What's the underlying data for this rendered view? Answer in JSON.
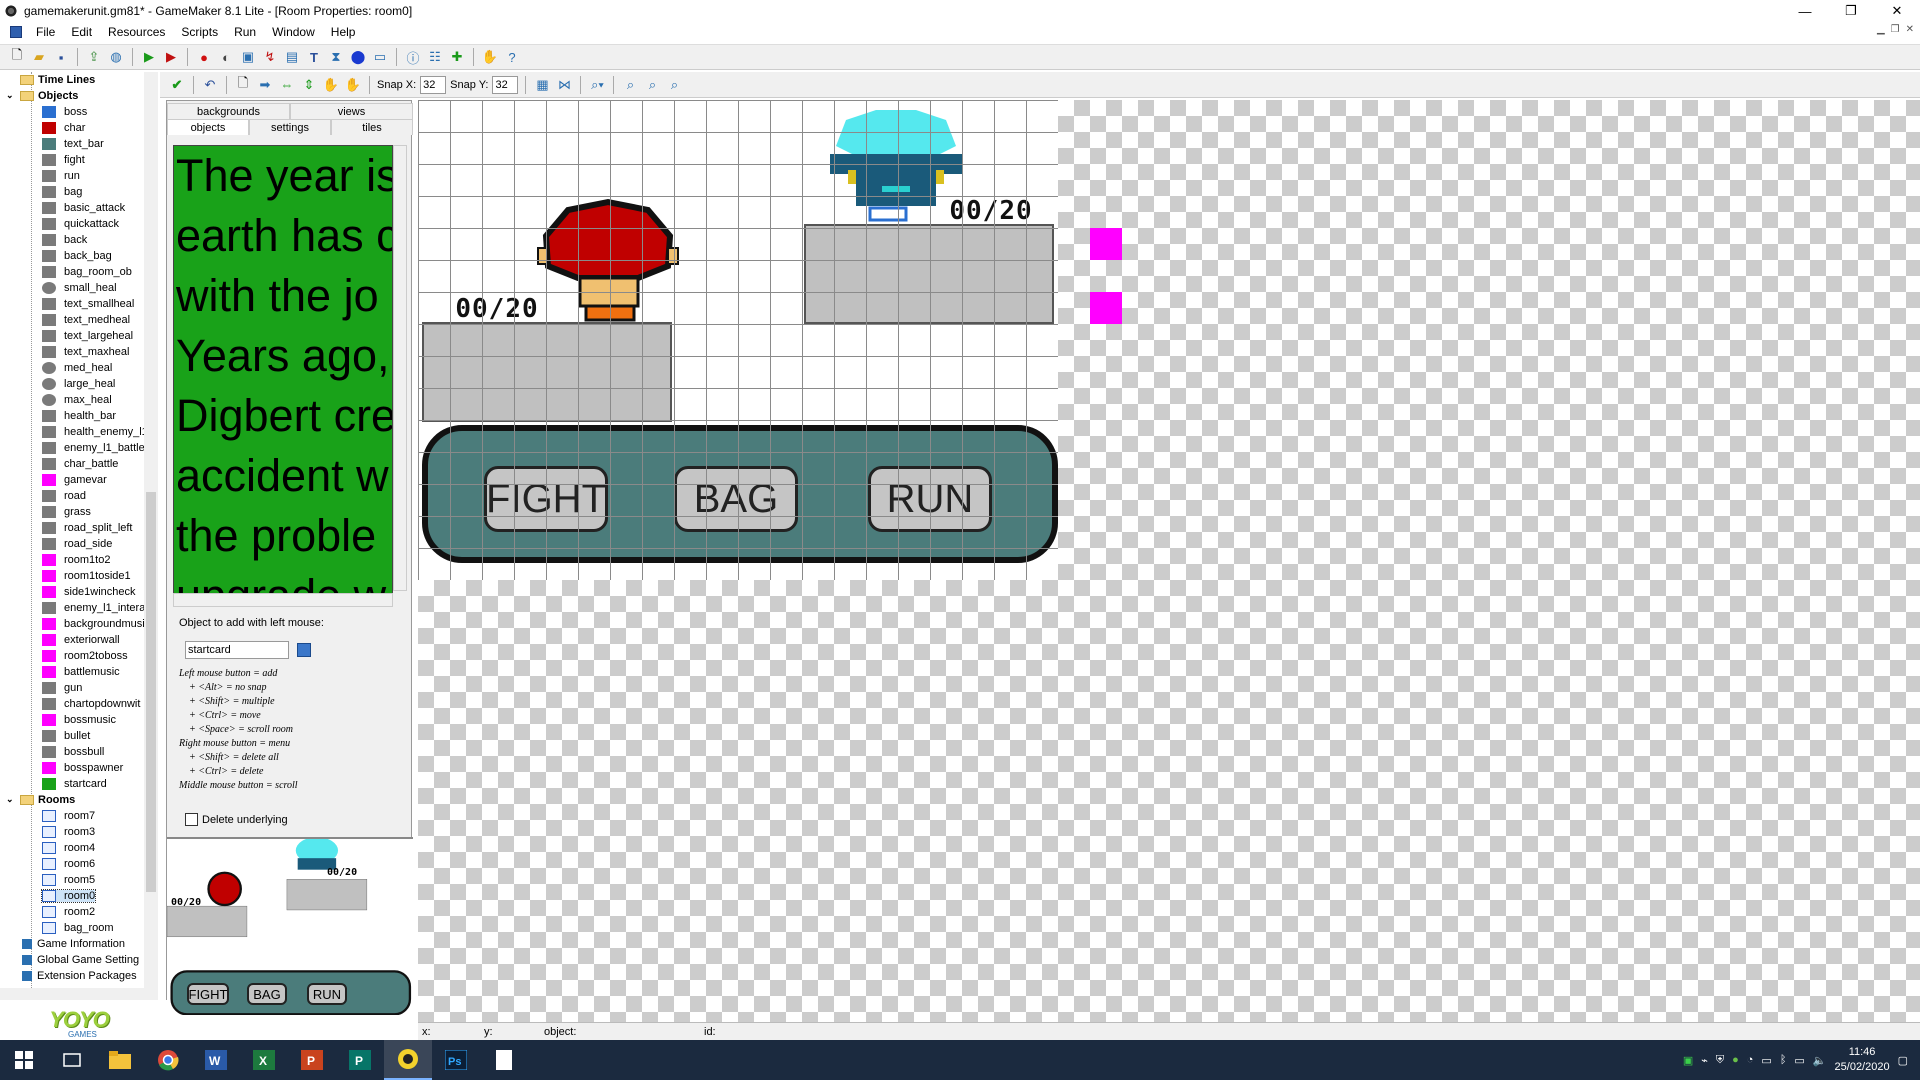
{
  "window": {
    "title": "gamemakerunit.gm81* - GameMaker 8.1 Lite - [Room Properties: room0]",
    "minimize": "—",
    "maximize": "❐",
    "close": "✕"
  },
  "menu": [
    "File",
    "Edit",
    "Resources",
    "Scripts",
    "Run",
    "Window",
    "Help"
  ],
  "tree": {
    "timelines_label": "Time Lines",
    "objects_label": "Objects",
    "objects": [
      "boss",
      "char",
      "text_bar",
      "fight",
      "run",
      "bag",
      "basic_attack",
      "quickattack",
      "back",
      "back_bag",
      "bag_room_ob",
      "small_heal",
      "text_smallheal",
      "text_medheal",
      "text_largeheal",
      "text_maxheal",
      "med_heal",
      "large_heal",
      "max_heal",
      "health_bar",
      "health_enemy_l1",
      "enemy_l1_battle",
      "char_battle",
      "gamevar",
      "road",
      "grass",
      "road_split_left",
      "road_side",
      "room1to2",
      "room1toside1",
      "side1wincheck",
      "enemy_l1_intera",
      "backgroundmusi",
      "exteriorwall",
      "room2toboss",
      "battlemusic",
      "gun",
      "chartopdownwit",
      "bossmusic",
      "bullet",
      "bossbull",
      "bosspawner",
      "startcard"
    ],
    "rooms_label": "Rooms",
    "rooms": [
      "room7",
      "room3",
      "room4",
      "room6",
      "room5",
      "room0",
      "room2",
      "bag_room"
    ],
    "selected_room": "room0",
    "extras": [
      "Game Information",
      "Global Game Setting",
      "Extension Packages"
    ]
  },
  "room_toolbar": {
    "snap_x_label": "Snap X:",
    "snap_x": "32",
    "snap_y_label": "Snap Y:",
    "snap_y": "32"
  },
  "tabs": {
    "row1": [
      "backgrounds",
      "views"
    ],
    "row2": [
      "objects",
      "settings",
      "tiles"
    ],
    "active": "objects"
  },
  "story_lines": [
    "The year is",
    "earth has c",
    "with the jo",
    "Years ago,",
    "Digbert cre",
    "accident w",
    "the proble",
    "upgrade w"
  ],
  "object_panel": {
    "label": "Object to add with left mouse:",
    "value": "startcard",
    "help": [
      "Left mouse button = add",
      "+ <Alt> = no snap",
      "+ <Shift> = multiple",
      "+ <Ctrl> = move",
      "+ <Space> = scroll room",
      "Right mouse button = menu",
      "+ <Shift> = delete all",
      "+ <Ctrl> = delete",
      "Middle mouse button = scroll"
    ],
    "delete_underlying": "Delete underlying"
  },
  "room": {
    "hp_player": "00/20",
    "hp_enemy": "00/20",
    "buttons": [
      "FIGHT",
      "BAG",
      "RUN"
    ]
  },
  "status": {
    "x": "x:",
    "y": "y:",
    "object": "object:",
    "id": "id:"
  },
  "yoyo": {
    "logo": "YOYO",
    "sub": "GAMES"
  },
  "clock": {
    "time": "11:46",
    "date": "25/02/2020"
  },
  "colors": {
    "story_bg": "#19a219",
    "menu_pill": "#4b7c7b",
    "marker": "#ff00ff"
  }
}
